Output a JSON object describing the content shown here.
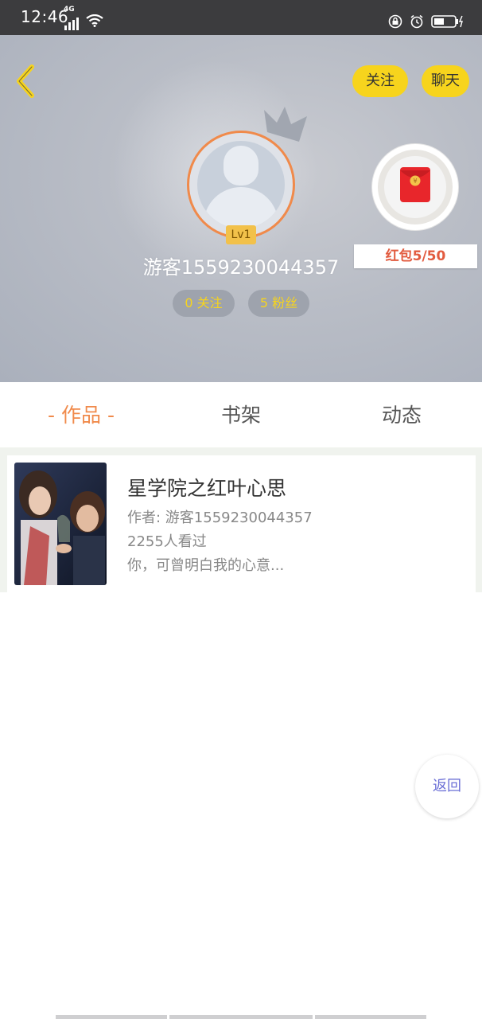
{
  "status_bar": {
    "time": "12:46",
    "network": "4G"
  },
  "header": {
    "follow_button": "关注",
    "chat_button": "聊天",
    "level": "Lv1",
    "username": "游客1559230044357",
    "following_count": "0 关注",
    "fans_count": "5 粉丝",
    "red_packet_label": "红包5/50"
  },
  "tabs": {
    "works": "- 作品 -",
    "bookshelf": "书架",
    "feed": "动态"
  },
  "works": [
    {
      "title": "星学院之红叶心思",
      "author": "作者: 游客1559230044357",
      "views": "2255人看过",
      "summary": "你，可曾明白我的心意..."
    }
  ],
  "return_button": "返回",
  "colors": {
    "accent_yellow": "#f7d41d",
    "accent_orange": "#f08a4b",
    "red_packet_text": "#e25b3f",
    "return_text": "#6b6fd6"
  }
}
